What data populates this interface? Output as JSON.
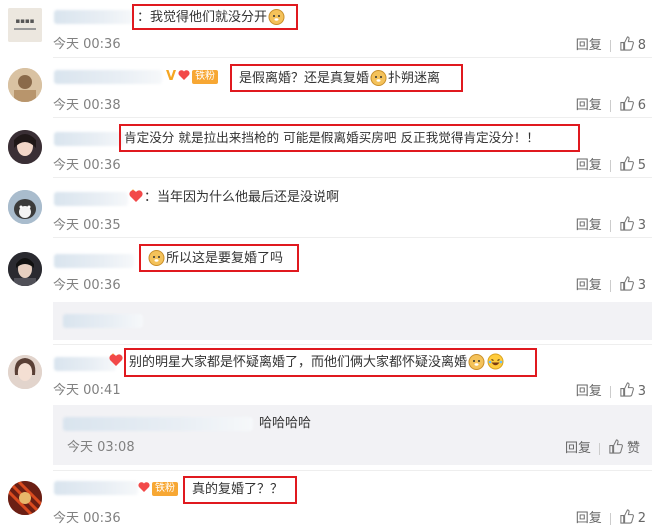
{
  "comments": [
    {
      "text": "：我觉得他们就没分开",
      "time": "今天 00:36",
      "reply": "回复",
      "likes": "8"
    },
    {
      "text": "是假离婚？还是真复婚",
      "text_after": "扑朔迷离",
      "time": "今天 00:38",
      "reply": "回复",
      "likes": "6",
      "badge": "铁粉"
    },
    {
      "text": "肯定没分 就是拉出来挡枪的 可能是假离婚买房吧 反正我觉得肯定没分！！",
      "time": "今天 00:36",
      "reply": "回复",
      "likes": "5"
    },
    {
      "text": "：当年因为什么他最后还是没说啊",
      "time": "今天 00:35",
      "reply": "回复",
      "likes": "3"
    },
    {
      "text": "所以这是要复婚了吗",
      "time": "今天 00:36",
      "reply": "回复",
      "likes": "3"
    },
    {
      "text": "别的明星大家都是怀疑离婚了，而他们俩大家都怀疑没离婚",
      "time": "今天 00:41",
      "reply": "回复",
      "likes": "3"
    },
    {
      "text": "真的复婚了？？",
      "time": "今天 00:36",
      "reply": "回复",
      "likes": "2",
      "badge": "铁粉"
    }
  ],
  "subreply": {
    "text": "哈哈哈哈",
    "time": "今天 03:08",
    "reply": "回复",
    "like_label": "赞"
  },
  "colors": {
    "highlight": "#e0191f",
    "time": "#808080",
    "badge": "#f7a733"
  }
}
